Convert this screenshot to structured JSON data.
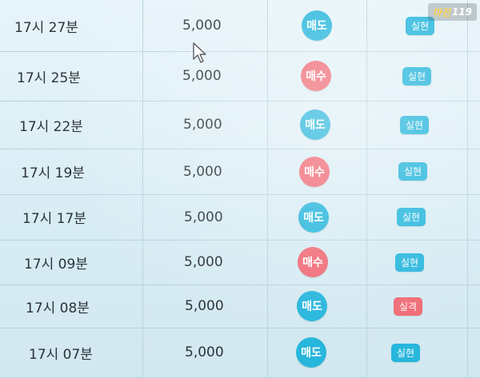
{
  "colors": {
    "sell": "#27b6dc",
    "buy": "#f06b76",
    "profit": "#27b6dc",
    "loss": "#f06b76"
  },
  "watermark": {
    "brand": "마진",
    "number": "119"
  },
  "trades": [
    {
      "time": "17시 27분",
      "amount": "5,000",
      "side": "매도",
      "side_type": "sell",
      "result": "실현",
      "result_type": "profit"
    },
    {
      "time": "17시 25분",
      "amount": "5,000",
      "side": "매수",
      "side_type": "buy",
      "result": "실현",
      "result_type": "profit"
    },
    {
      "time": "17시 22분",
      "amount": "5,000",
      "side": "매도",
      "side_type": "sell",
      "result": "실현",
      "result_type": "profit"
    },
    {
      "time": "17시 19분",
      "amount": "5,000",
      "side": "매수",
      "side_type": "buy",
      "result": "실현",
      "result_type": "profit"
    },
    {
      "time": "17시 17분",
      "amount": "5,000",
      "side": "매도",
      "side_type": "sell",
      "result": "실현",
      "result_type": "profit"
    },
    {
      "time": "17시 09분",
      "amount": "5,000",
      "side": "매수",
      "side_type": "buy",
      "result": "실현",
      "result_type": "profit"
    },
    {
      "time": "17시 08분",
      "amount": "5,000",
      "side": "매도",
      "side_type": "sell",
      "result": "실격",
      "result_type": "loss"
    },
    {
      "time": "17시 07분",
      "amount": "5,000",
      "side": "매도",
      "side_type": "sell",
      "result": "실현",
      "result_type": "profit"
    }
  ]
}
